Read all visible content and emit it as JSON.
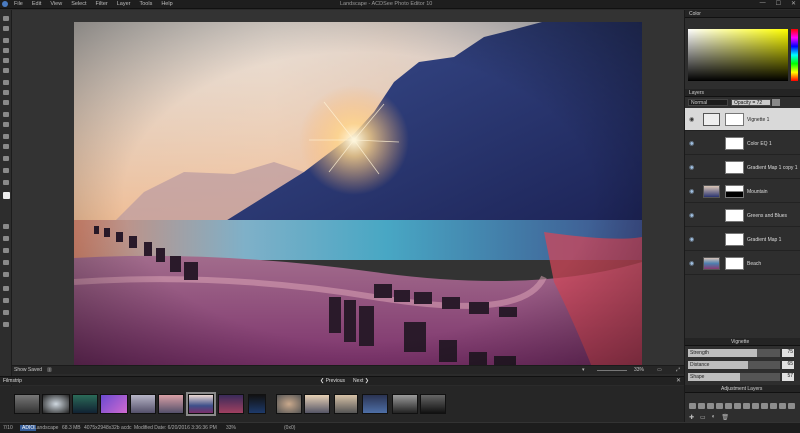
{
  "app": {
    "title": "Landscape - ACDSee Photo Editor 10",
    "menu": [
      "File",
      "Edit",
      "View",
      "Select",
      "Filter",
      "Layer",
      "Tools",
      "Help"
    ]
  },
  "viewer": {
    "show_saved": "Show Saved",
    "zoom": "33%"
  },
  "filmstrip": {
    "title": "Filmstrip",
    "prev": "Previous",
    "next": "Next"
  },
  "status": {
    "count": "7/10",
    "format": "ADIO",
    "filename": "Landscape",
    "size": "68.3 MB",
    "dimensions": "4075x2948x32b acdc",
    "modified": "Modified Date: 6/20/2016 3:36:36 PM",
    "zoom": "33%",
    "coords": "(0x0)"
  },
  "panels": {
    "color_title": "Color",
    "layers_title": "Layers",
    "blend_mode": "Normal",
    "opacity": "Opacity = 72",
    "vignette_title": "Vignette",
    "adjustment_title": "Adjustment Layers"
  },
  "layers": [
    {
      "name": "Vignette 1",
      "active": true
    },
    {
      "name": "Color EQ 1",
      "active": false
    },
    {
      "name": "Gradient Map 1 copy 1",
      "active": false
    },
    {
      "name": "Mountain",
      "active": false
    },
    {
      "name": "Greens and Blues",
      "active": false
    },
    {
      "name": "Gradient Map 1",
      "active": false
    },
    {
      "name": "Beach",
      "active": false
    }
  ],
  "vignette": {
    "strength_label": "Strength",
    "strength": 75,
    "distance_label": "Distance",
    "distance": 65,
    "shape_label": "Shape",
    "shape": 57
  }
}
